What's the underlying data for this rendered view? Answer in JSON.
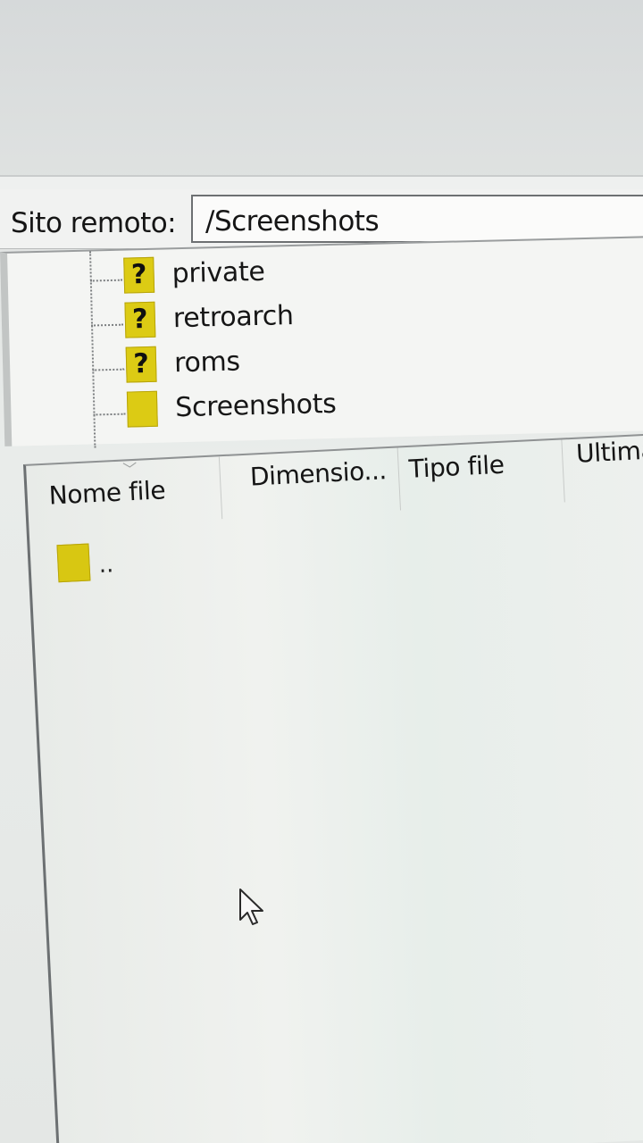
{
  "remote_site": {
    "label": "Sito remoto:",
    "path": "/Screenshots"
  },
  "tree": {
    "items": [
      {
        "label": "private",
        "icon": "unknown-folder-icon",
        "badge": "?"
      },
      {
        "label": "retroarch",
        "icon": "unknown-folder-icon",
        "badge": "?"
      },
      {
        "label": "roms",
        "icon": "unknown-folder-icon",
        "badge": "?"
      },
      {
        "label": "Screenshots",
        "icon": "folder-icon",
        "badge": ""
      }
    ]
  },
  "file_list": {
    "columns": [
      "Nome file",
      "Dimensio...",
      "Tipo file",
      "Ultima"
    ],
    "rows": [
      {
        "name": "..",
        "icon": "folder-icon"
      }
    ]
  },
  "colors": {
    "folder": "#dccb14",
    "panel_border": "#6c7072",
    "background": "#e9ecea"
  }
}
